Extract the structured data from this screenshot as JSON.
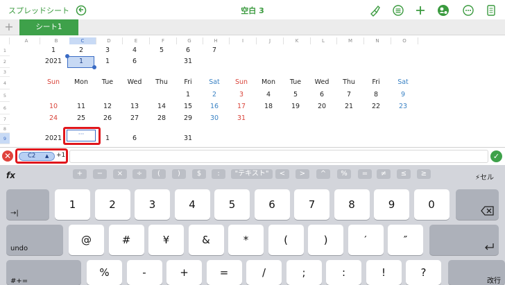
{
  "toolbar": {
    "back_label": "スプレッドシート",
    "title": "空白 3",
    "icons": [
      "undo-icon",
      "paintbrush-icon",
      "format-list-icon",
      "add-icon",
      "collaborate-icon",
      "more-icon",
      "document-icon"
    ]
  },
  "tabs": {
    "add_label": "+",
    "sheet_name": "シート1"
  },
  "grid": {
    "columns": [
      "A",
      "B",
      "C",
      "D",
      "E",
      "F",
      "G",
      "H",
      "I",
      "J",
      "K",
      "L",
      "M",
      "N",
      "O"
    ],
    "selected_column": "C",
    "rows": [
      "1",
      "2",
      "3",
      "4",
      "5",
      "6",
      "7",
      "8",
      "9"
    ],
    "selected_row": "9",
    "row1": [
      "1",
      "2",
      "3",
      "4",
      "5",
      "6",
      "7"
    ],
    "row2": {
      "year": "2021",
      "month": "1",
      "d": "1",
      "e": "6",
      "g": "31"
    },
    "weekdays": [
      "Sun",
      "Mon",
      "Tue",
      "Wed",
      "Thu",
      "Fri",
      "Sat"
    ],
    "week1": [
      "",
      "",
      "",
      "",
      "",
      "1",
      "2"
    ],
    "week1b": [
      "3",
      "4",
      "5",
      "6",
      "7",
      "8",
      "9"
    ],
    "week2": [
      "10",
      "11",
      "12",
      "13",
      "14",
      "15",
      "16",
      "17",
      "18",
      "19",
      "20",
      "21",
      "22",
      "23"
    ],
    "week3": [
      "24",
      "25",
      "26",
      "27",
      "28",
      "29",
      "30",
      "31"
    ],
    "row9": {
      "year": "2021",
      "edit": "···",
      "d": "1",
      "e": "6",
      "g": "31"
    },
    "colors": {
      "sunday": "#d9443a",
      "saturday": "#3a82c4",
      "selection": "#3a6bc4"
    }
  },
  "formula": {
    "token": "C2",
    "suffix": "+1"
  },
  "keyboard": {
    "fx": "fx",
    "functions": [
      "+",
      "−",
      "×",
      "÷",
      "(",
      ")",
      "$",
      ":",
      "\"テキスト\"",
      "<",
      ">",
      "^",
      "%",
      "=",
      "≠",
      "≤",
      "≥"
    ],
    "cell_label": "セル",
    "row1": [
      "1",
      "2",
      "3",
      "4",
      "5",
      "6",
      "7",
      "8",
      "9",
      "0"
    ],
    "row2": [
      "@",
      "#",
      "¥",
      "&",
      "*",
      "(",
      ")",
      "′",
      "″"
    ],
    "row3": [
      "%",
      "-",
      "+",
      "=",
      "/",
      ";",
      ":",
      "!",
      "?"
    ],
    "tab_key": "→|",
    "undo_key": "undo",
    "shift_key": "#+=",
    "return_key": "改行"
  }
}
